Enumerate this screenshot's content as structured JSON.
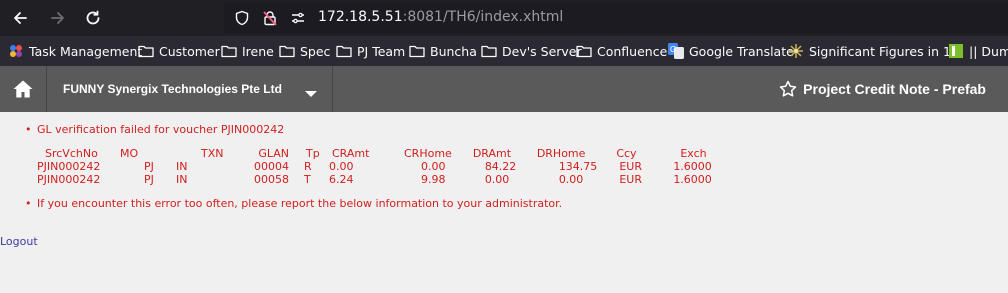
{
  "browser": {
    "url_host": "172.18.5.51",
    "url_rest": ":8081/TH6/index.xhtml"
  },
  "bookmarks": [
    {
      "label": "Task Management",
      "icon": "task-app-icon"
    },
    {
      "label": "Customer",
      "icon": "folder-icon"
    },
    {
      "label": "Irene",
      "icon": "folder-icon"
    },
    {
      "label": "Spec",
      "icon": "folder-icon"
    },
    {
      "label": "PJ Team",
      "icon": "folder-icon"
    },
    {
      "label": "Buncha",
      "icon": "folder-icon"
    },
    {
      "label": "Dev's Server",
      "icon": "folder-icon"
    },
    {
      "label": "Confluence",
      "icon": "folder-icon"
    },
    {
      "label": "Google Translate",
      "icon": "google-translate-icon"
    },
    {
      "label": "Significant Figures in 1...",
      "icon": "sparkle-icon"
    },
    {
      "label": "|| Dumm",
      "icon": "green-square-icon"
    }
  ],
  "header": {
    "company": "FUNNY Synergix Technologies Pte Ltd",
    "page_title": "Project Credit Note - Prefab"
  },
  "messages": {
    "error1": "GL verification failed for voucher PJIN000242",
    "error2": "If you encounter this error too often, please report the below information to your administrator."
  },
  "table": {
    "columns": [
      "SrcVchNo",
      "MO",
      "TXN",
      "GLAN",
      "Tp",
      "CRAmt",
      "CRHome",
      "DRAmt",
      "DRHome",
      "Ccy",
      "Exch"
    ],
    "rows": [
      [
        "PJIN000242",
        "PJ",
        "IN",
        "00004",
        "R",
        "0.00",
        "0.00",
        "84.22",
        "134.75",
        "EUR",
        "1.6000"
      ],
      [
        "PJIN000242",
        "PJ",
        "IN",
        "00058",
        "T",
        "6.24",
        "9.98",
        "0.00",
        "0.00",
        "EUR",
        "1.6000"
      ]
    ]
  },
  "footer": {
    "logout_label": "Logout"
  }
}
